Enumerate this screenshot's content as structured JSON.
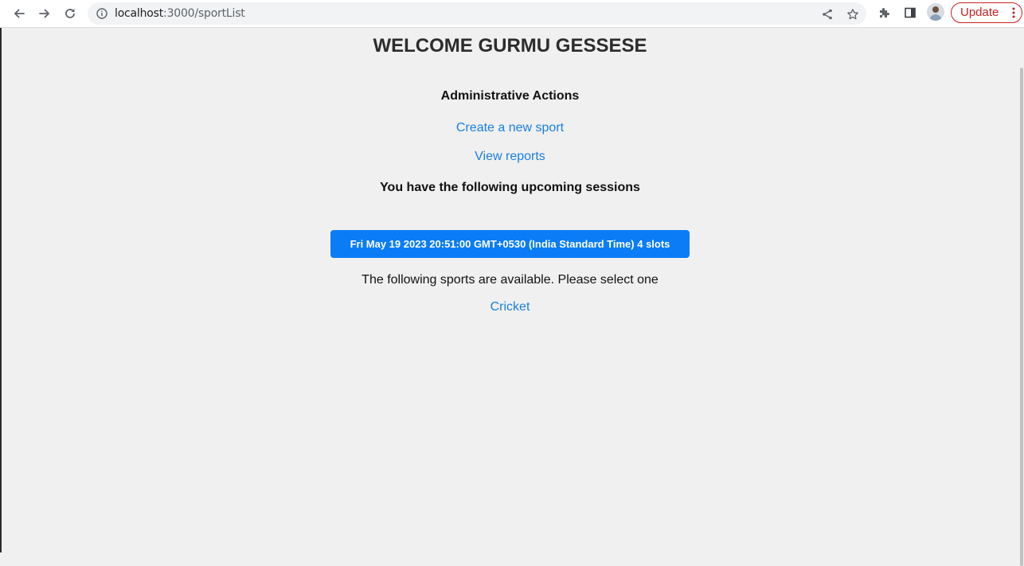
{
  "browser": {
    "url_host": "localhost",
    "url_path": ":3000/sportList",
    "update_label": "Update"
  },
  "page": {
    "welcome": "WELCOME GURMU GESSESE",
    "admin_heading": "Administrative Actions",
    "create_sport_link": "Create a new sport",
    "view_reports_link": "View reports",
    "sessions_heading": "You have the following upcoming sessions",
    "sessions": [
      {
        "label": "Fri May 19 2023 20:51:00 GMT+0530 (India Standard Time) 4 slots"
      }
    ],
    "sports_prompt": "The following sports are available. Please select one",
    "sports": [
      {
        "name": "Cricket"
      }
    ]
  },
  "colors": {
    "link": "#1a7fe0",
    "session_button": "#0a7cf5",
    "page_background": "#f0f0f0",
    "update_accent": "#c5221f"
  }
}
